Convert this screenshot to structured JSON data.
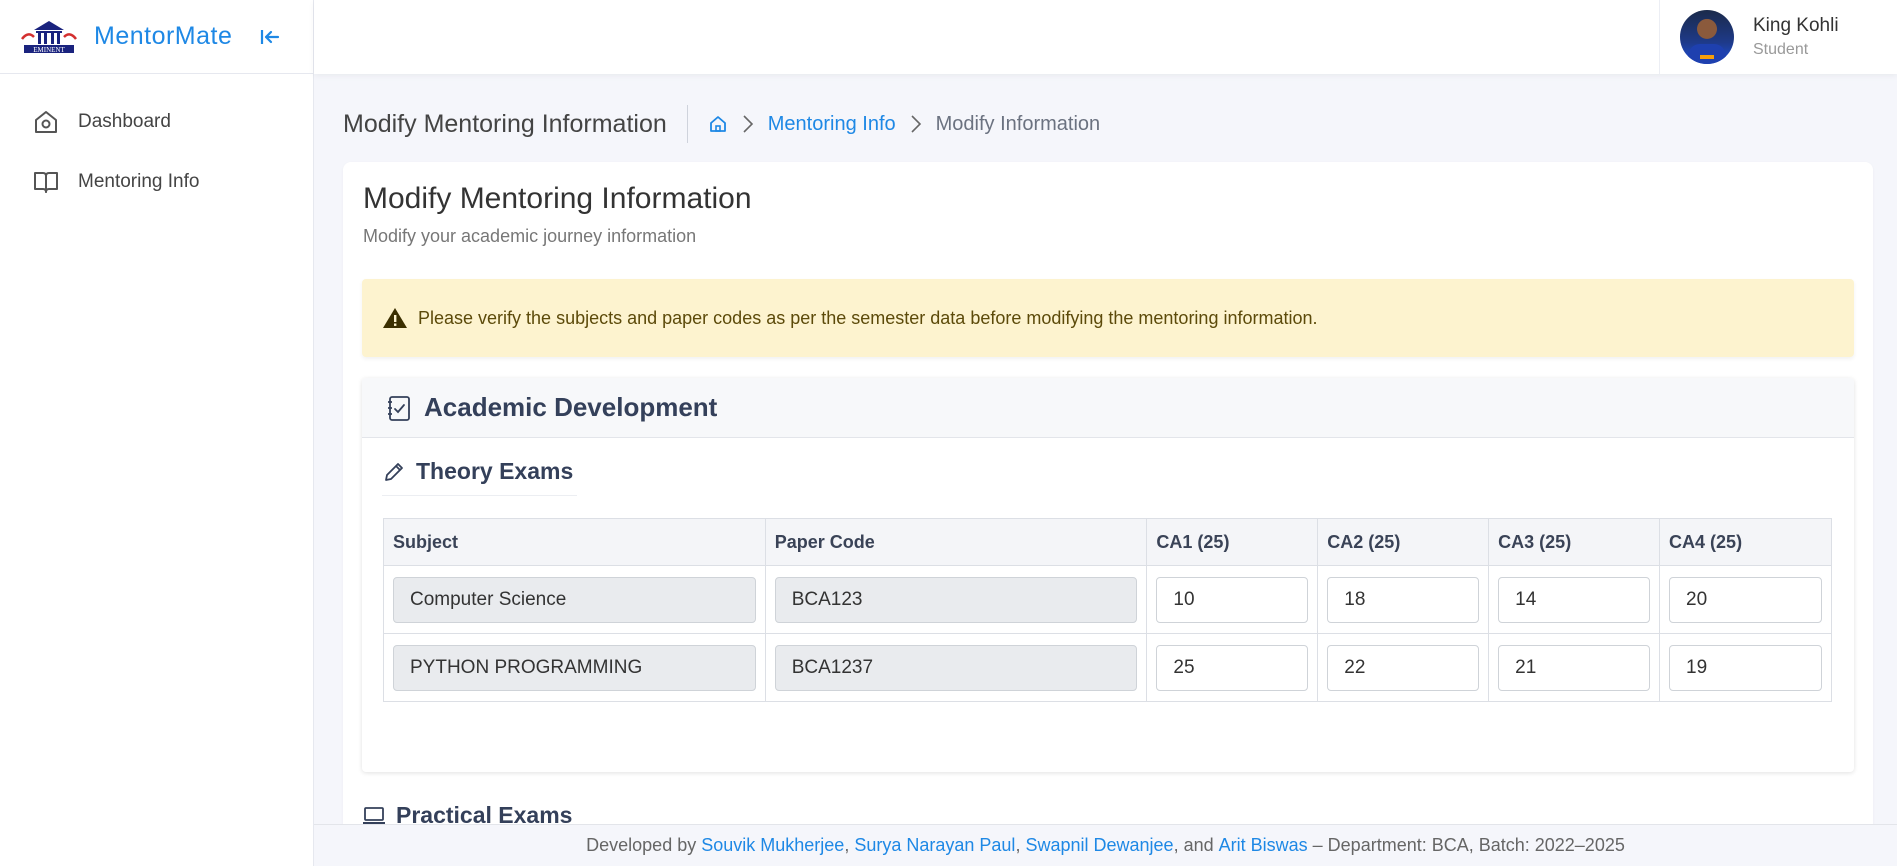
{
  "app": {
    "name": "MentorMate"
  },
  "sidebar": {
    "items": [
      {
        "label": "Dashboard",
        "icon": "home-icon"
      },
      {
        "label": "Mentoring Info",
        "icon": "book-icon"
      }
    ]
  },
  "user": {
    "name": "King Kohli",
    "role": "Student"
  },
  "page": {
    "title": "Modify Mentoring Information",
    "breadcrumb": {
      "home_icon": "home-icon",
      "parent": "Mentoring Info",
      "current": "Modify Information"
    }
  },
  "card": {
    "title": "Modify Mentoring Information",
    "subtitle": "Modify your academic journey information"
  },
  "alert": {
    "text": "Please verify the subjects and paper codes as per the semester data before modifying the mentoring information.",
    "icon": "warning-icon"
  },
  "academic": {
    "title": "Academic Development",
    "theory": {
      "title": "Theory Exams",
      "headers": [
        "Subject",
        "Paper Code",
        "CA1 (25)",
        "CA2 (25)",
        "CA3 (25)",
        "CA4 (25)"
      ],
      "rows": [
        {
          "subject": "Computer Science",
          "code": "BCA123",
          "ca1": "10",
          "ca2": "18",
          "ca3": "14",
          "ca4": "20"
        },
        {
          "subject": "PYTHON PROGRAMMING",
          "code": "BCA1237",
          "ca1": "25",
          "ca2": "22",
          "ca3": "21",
          "ca4": "19"
        }
      ]
    },
    "practical": {
      "title": "Practical Exams"
    }
  },
  "footer": {
    "prefix": "Developed by",
    "authors": [
      "Souvik Mukherjee",
      "Surya Narayan Paul",
      "Swapnil Dewanjee",
      "Arit Biswas"
    ],
    "sep1": ",",
    "sep2": ",",
    "and": ", and",
    "suffix": "– Department: BCA, Batch: 2022–2025"
  },
  "colors": {
    "accent": "#1e88e5",
    "alert_bg": "#fdf3cf",
    "heading": "#34405a"
  }
}
